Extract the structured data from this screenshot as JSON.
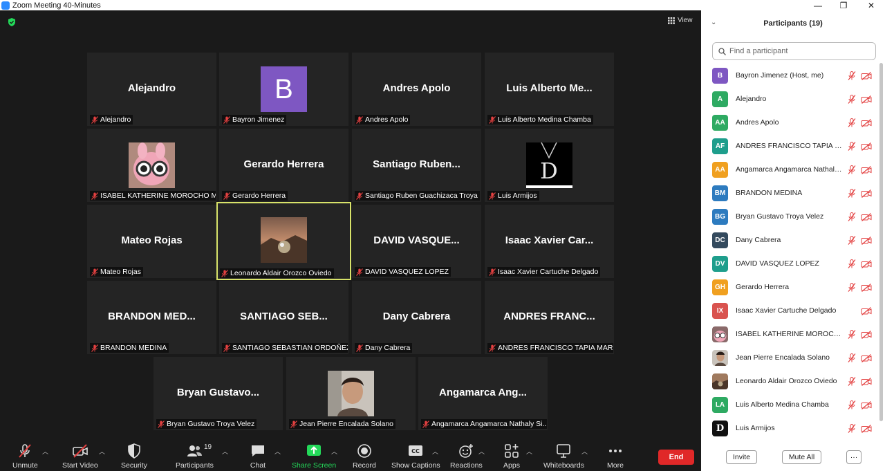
{
  "window": {
    "title": "Zoom Meeting 40-Minutes",
    "minimize": "—",
    "maximize": "❐",
    "close": "✕"
  },
  "view_label": "View",
  "tiles": [
    {
      "name": "Alejandro",
      "label": "Alejandro"
    },
    {
      "name": "",
      "label": "Bayron Jimenez",
      "avatar_letter": "B"
    },
    {
      "name": "Andres Apolo",
      "label": "Andres Apolo"
    },
    {
      "name": "Luis Alberto Me...",
      "label": "Luis Alberto Medina Chamba"
    },
    {
      "name": "",
      "label": "ISABEL KATHERINE MOROCHO M..."
    },
    {
      "name": "Gerardo Herrera",
      "label": "Gerardo Herrera"
    },
    {
      "name": "Santiago Ruben...",
      "label": "Santiago Ruben Guachizaca Troya"
    },
    {
      "name": "",
      "label": "Luis Armijos",
      "avatar_letter": "D"
    },
    {
      "name": "Mateo Rojas",
      "label": "Mateo Rojas"
    },
    {
      "name": "",
      "label": "Leonardo Aldair Orozco Oviedo"
    },
    {
      "name": "DAVID VASQUE...",
      "label": "DAVID VASQUEZ LOPEZ"
    },
    {
      "name": "Isaac Xavier Car...",
      "label": "Isaac Xavier Cartuche Delgado"
    },
    {
      "name": "BRANDON MED...",
      "label": "BRANDON MEDINA"
    },
    {
      "name": "SANTIAGO SEB...",
      "label": "SANTIAGO SEBASTIAN ORDOÑEZ..."
    },
    {
      "name": "Dany Cabrera",
      "label": "Dany Cabrera"
    },
    {
      "name": "ANDRES FRANC...",
      "label": "ANDRES FRANCISCO TAPIA MAR..."
    },
    {
      "name": "Bryan Gustavo...",
      "label": "Bryan Gustavo Troya Velez"
    },
    {
      "name": "",
      "label": "Jean Pierre Encalada Solano"
    },
    {
      "name": "Angamarca Ang...",
      "label": "Angamarca Angamarca Nathaly Si..."
    }
  ],
  "toolbar": {
    "unmute": "Unmute",
    "start_video": "Start Video",
    "security": "Security",
    "participants": "Participants",
    "participants_count": "19",
    "chat": "Chat",
    "share_screen": "Share Screen",
    "record": "Record",
    "show_captions": "Show Captions",
    "captions_badge": "CC",
    "reactions": "Reactions",
    "apps": "Apps",
    "whiteboards": "Whiteboards",
    "more": "More",
    "end": "End"
  },
  "panel": {
    "title": "Participants (19)",
    "search_placeholder": "Find a participant",
    "invite": "Invite",
    "mute_all": "Mute All",
    "more": "···"
  },
  "participants": [
    {
      "initials": "B",
      "name": "Bayron Jimenez (Host, me)",
      "color": "#7e57c2"
    },
    {
      "initials": "A",
      "name": "Alejandro",
      "color": "#2eaa62"
    },
    {
      "initials": "AA",
      "name": "Andres Apolo",
      "color": "#2eaa62"
    },
    {
      "initials": "AF",
      "name": "ANDRES FRANCISCO TAPIA MA...",
      "color": "#1e9e8c"
    },
    {
      "initials": "AA",
      "name": "Angamarca Angamarca Nathaly ...",
      "color": "#f0a020"
    },
    {
      "initials": "BM",
      "name": "BRANDON MEDINA",
      "color": "#2d7bbf"
    },
    {
      "initials": "BG",
      "name": "Bryan Gustavo Troya Velez",
      "color": "#2d7bbf"
    },
    {
      "initials": "DC",
      "name": "Dany Cabrera",
      "color": "#344a5e"
    },
    {
      "initials": "DV",
      "name": "DAVID VASQUEZ LOPEZ",
      "color": "#1e9e8c"
    },
    {
      "initials": "GH",
      "name": "Gerardo Herrera",
      "color": "#f0a020"
    },
    {
      "initials": "IX",
      "name": "Isaac Xavier Cartuche Delgado",
      "color": "#d9534f"
    },
    {
      "initials": "",
      "name": "ISABEL KATHERINE MOROCHO ...",
      "color": "#8a6a6a"
    },
    {
      "initials": "",
      "name": "Jean Pierre Encalada Solano",
      "color": "#8a6a55"
    },
    {
      "initials": "",
      "name": "Leonardo Aldair Orozco Oviedo",
      "color": "#6b5040"
    },
    {
      "initials": "LA",
      "name": "Luis Alberto Medina Chamba",
      "color": "#2eaa62"
    },
    {
      "initials": "D",
      "name": "Luis Armijos",
      "color": "#111111"
    }
  ]
}
